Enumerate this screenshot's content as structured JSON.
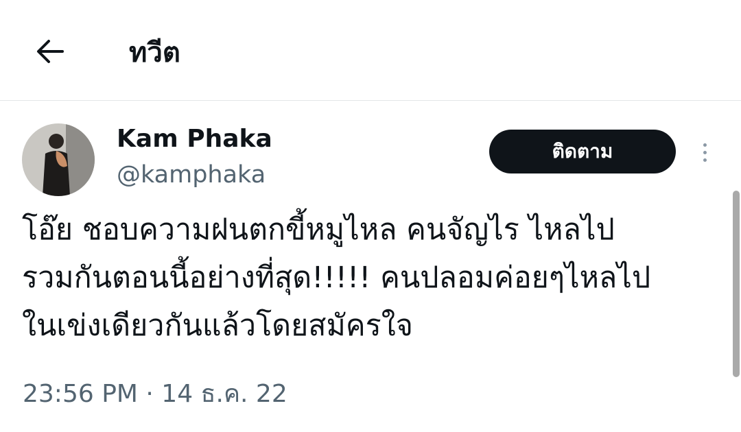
{
  "header": {
    "title": "ทวีต",
    "back_icon": "arrow-left-icon"
  },
  "author": {
    "display_name": "Kam Phaka",
    "handle": "@kamphaka",
    "avatar_icon": "profile-photo"
  },
  "follow_button": {
    "label": "ติดตาม"
  },
  "more_icon": "more-vertical-icon",
  "tweet": {
    "text": "โอ๊ย ชอบความฝนตกขี้หมูไหล คนจัญไร ไหลไป\nรวมกันตอนนี้อย่างที่สุด!!!!! คนปลอมค่อยๆไหลไป\nในเข่งเดียวกันแล้วโดยสมัครใจ",
    "timestamp": "23:56 PM · 14 ธ.ค. 22"
  },
  "colors": {
    "text": "#0f1419",
    "secondary": "#536471",
    "button_bg": "#0f1419"
  }
}
